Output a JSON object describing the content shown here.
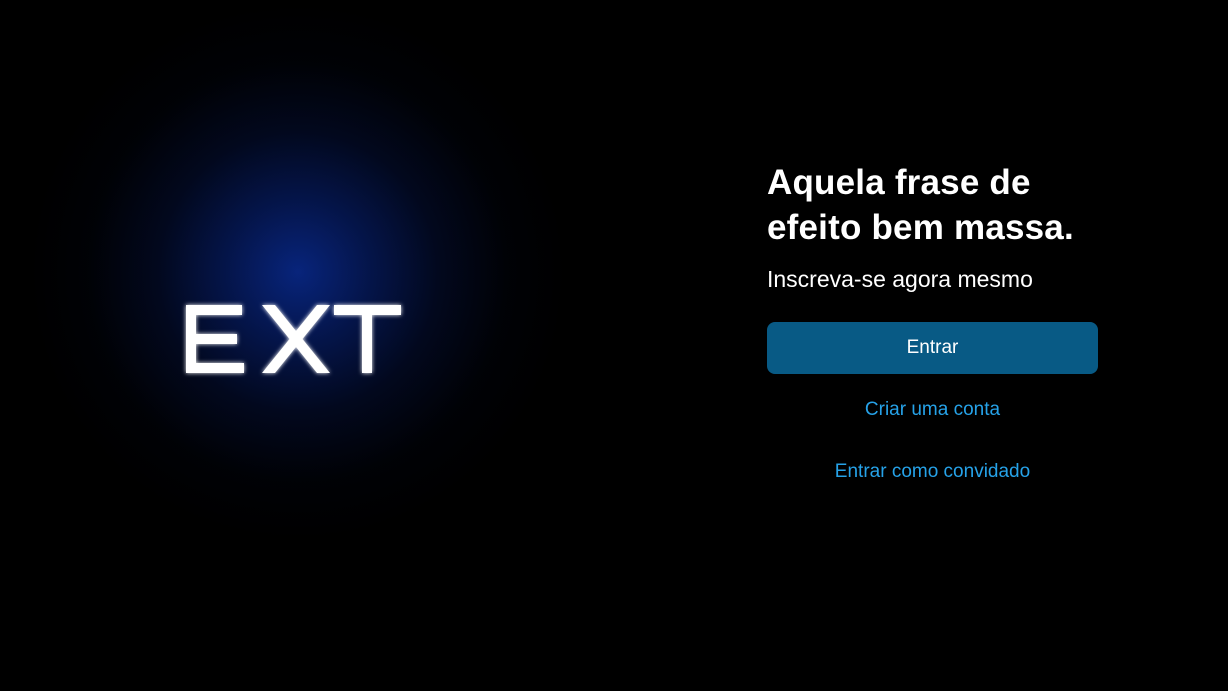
{
  "logo": {
    "text": "EXT"
  },
  "hero": {
    "headline": "Aquela frase de efeito bem massa.",
    "subtitle": "Inscreva-se agora mesmo"
  },
  "actions": {
    "login_label": "Entrar",
    "create_account_label": "Criar uma conta",
    "guest_label": "Entrar como convidado"
  },
  "colors": {
    "background": "#000000",
    "glow": "#0a2a8a",
    "primary_button": "#085a85",
    "link": "#26a2e8",
    "text": "#ffffff"
  }
}
